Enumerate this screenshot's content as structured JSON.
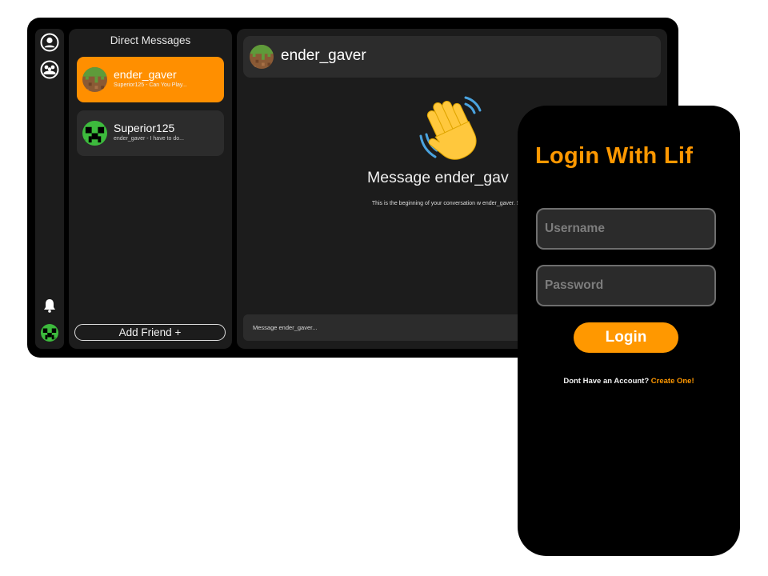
{
  "colors": {
    "accent": "#ff9800",
    "window_bg": "#000000",
    "panel_bg": "#1c1c1c",
    "item_bg": "#2c2c2c"
  },
  "sidebar_rail": {
    "icons": [
      "profile-icon",
      "group-icon",
      "bell-icon",
      "creeper-avatar-icon"
    ]
  },
  "direct_messages": {
    "title": "Direct Messages",
    "conversations": [
      {
        "name": "ender_gaver",
        "preview": "Superior125 - Can You Play...",
        "avatar": "grass-block-avatar",
        "active": true
      },
      {
        "name": "Superior125",
        "preview": "ender_gaver - I have to do...",
        "avatar": "creeper-avatar",
        "active": false
      }
    ],
    "add_friend_label": "Add Friend +"
  },
  "chat": {
    "header_name": "ender_gaver",
    "welcome_heading": "Message ender_gav",
    "welcome_text": "This is the beginning of your conversation w ender_gaver. Say hi!",
    "wave_icon": "waving-hand-icon",
    "input_placeholder": "Message ender_gaver..."
  },
  "login": {
    "title": "Login With Lif",
    "username_placeholder": "Username",
    "password_placeholder": "Password",
    "login_button": "Login",
    "no_account_text": "Dont Have an Account?",
    "create_link": "Create One!"
  }
}
